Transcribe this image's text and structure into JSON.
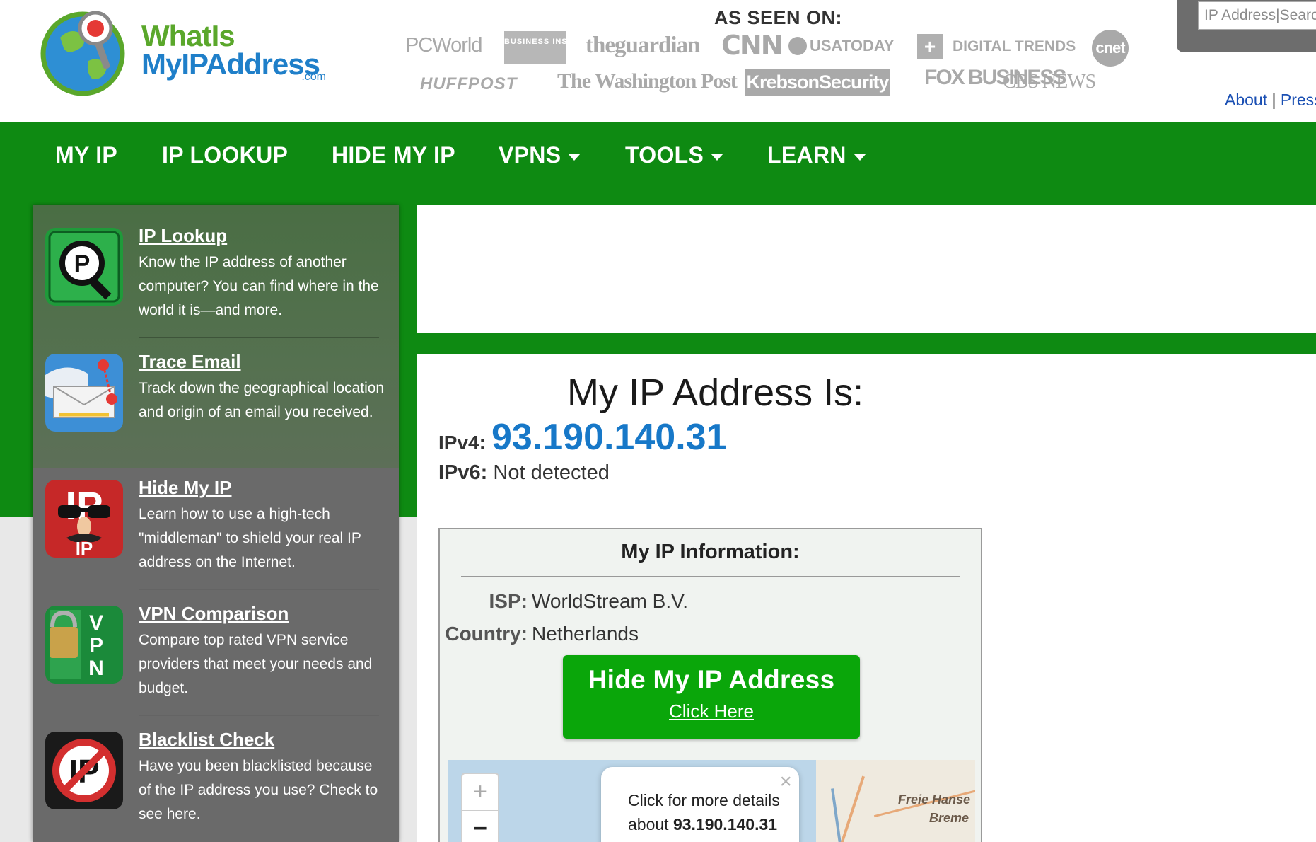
{
  "logo": {
    "line1": "WhatIs",
    "line2": "MyIPAddress",
    "suffix": ".com"
  },
  "as_seen_on": {
    "title": "AS SEEN ON:",
    "outlets": [
      "PCWorld",
      "BUSINESS INSIDER",
      "theguardian",
      "CNN",
      "USATODAY",
      "DIGITAL TRENDS",
      "cnet",
      "HUFFPOST",
      "The Washington Post",
      "KrebsonSecurity",
      "FOX BUSINESS",
      "CBS NEWS"
    ]
  },
  "search": {
    "placeholder": "IP Address|Search"
  },
  "top_links": {
    "about": "About",
    "separator": "|",
    "press": "Press"
  },
  "nav": [
    {
      "label": "MY IP",
      "dropdown": false
    },
    {
      "label": "IP LOOKUP",
      "dropdown": false
    },
    {
      "label": "HIDE MY IP",
      "dropdown": false
    },
    {
      "label": "VPNS",
      "dropdown": true
    },
    {
      "label": "TOOLS",
      "dropdown": true
    },
    {
      "label": "LEARN",
      "dropdown": true
    }
  ],
  "sidebar": {
    "items": [
      {
        "title": "IP Lookup",
        "desc": "Know the IP address of another computer? You can find where in the world it is—and more.",
        "icon": "ip-lookup-icon"
      },
      {
        "title": "Trace Email",
        "desc": "Track down the geographical location and origin of an email you received.",
        "icon": "trace-email-icon"
      },
      {
        "title": "Hide My IP",
        "desc": "Learn how to use a high-tech \"middleman\" to shield your real IP address on the Internet.",
        "icon": "hide-my-ip-icon"
      },
      {
        "title": "VPN Comparison",
        "desc": "Compare top rated VPN service providers that meet your needs and budget.",
        "icon": "vpn-icon"
      },
      {
        "title": "Blacklist Check",
        "desc": "Have you been blacklisted because of the IP address you use? Check to see here.",
        "icon": "blacklist-icon"
      }
    ]
  },
  "main": {
    "heading": "My IP Address Is:",
    "ipv4_label": "IPv4:",
    "ipv4_value": "93.190.140.31",
    "ipv6_label": "IPv6:",
    "ipv6_value": "Not detected",
    "info": {
      "title": "My IP Information:",
      "isp_label": "ISP:",
      "isp_value": "WorldStream B.V.",
      "country_label": "Country:",
      "country_value": "Netherlands"
    },
    "hide_button": {
      "title": "Hide My IP Address",
      "link": "Click Here"
    },
    "map": {
      "zoom_in": "+",
      "zoom_out": "−",
      "popup_line1": "Click for more details",
      "popup_line2_prefix": "about",
      "popup_ip": "93.190.140.31",
      "label1": "Freie Hanse",
      "label2": "Breme"
    }
  },
  "colors": {
    "nav_green": "#0e8a12",
    "ip_blue": "#1778c8",
    "button_green": "#0aa60a",
    "link_blue": "#1a4fb3"
  }
}
